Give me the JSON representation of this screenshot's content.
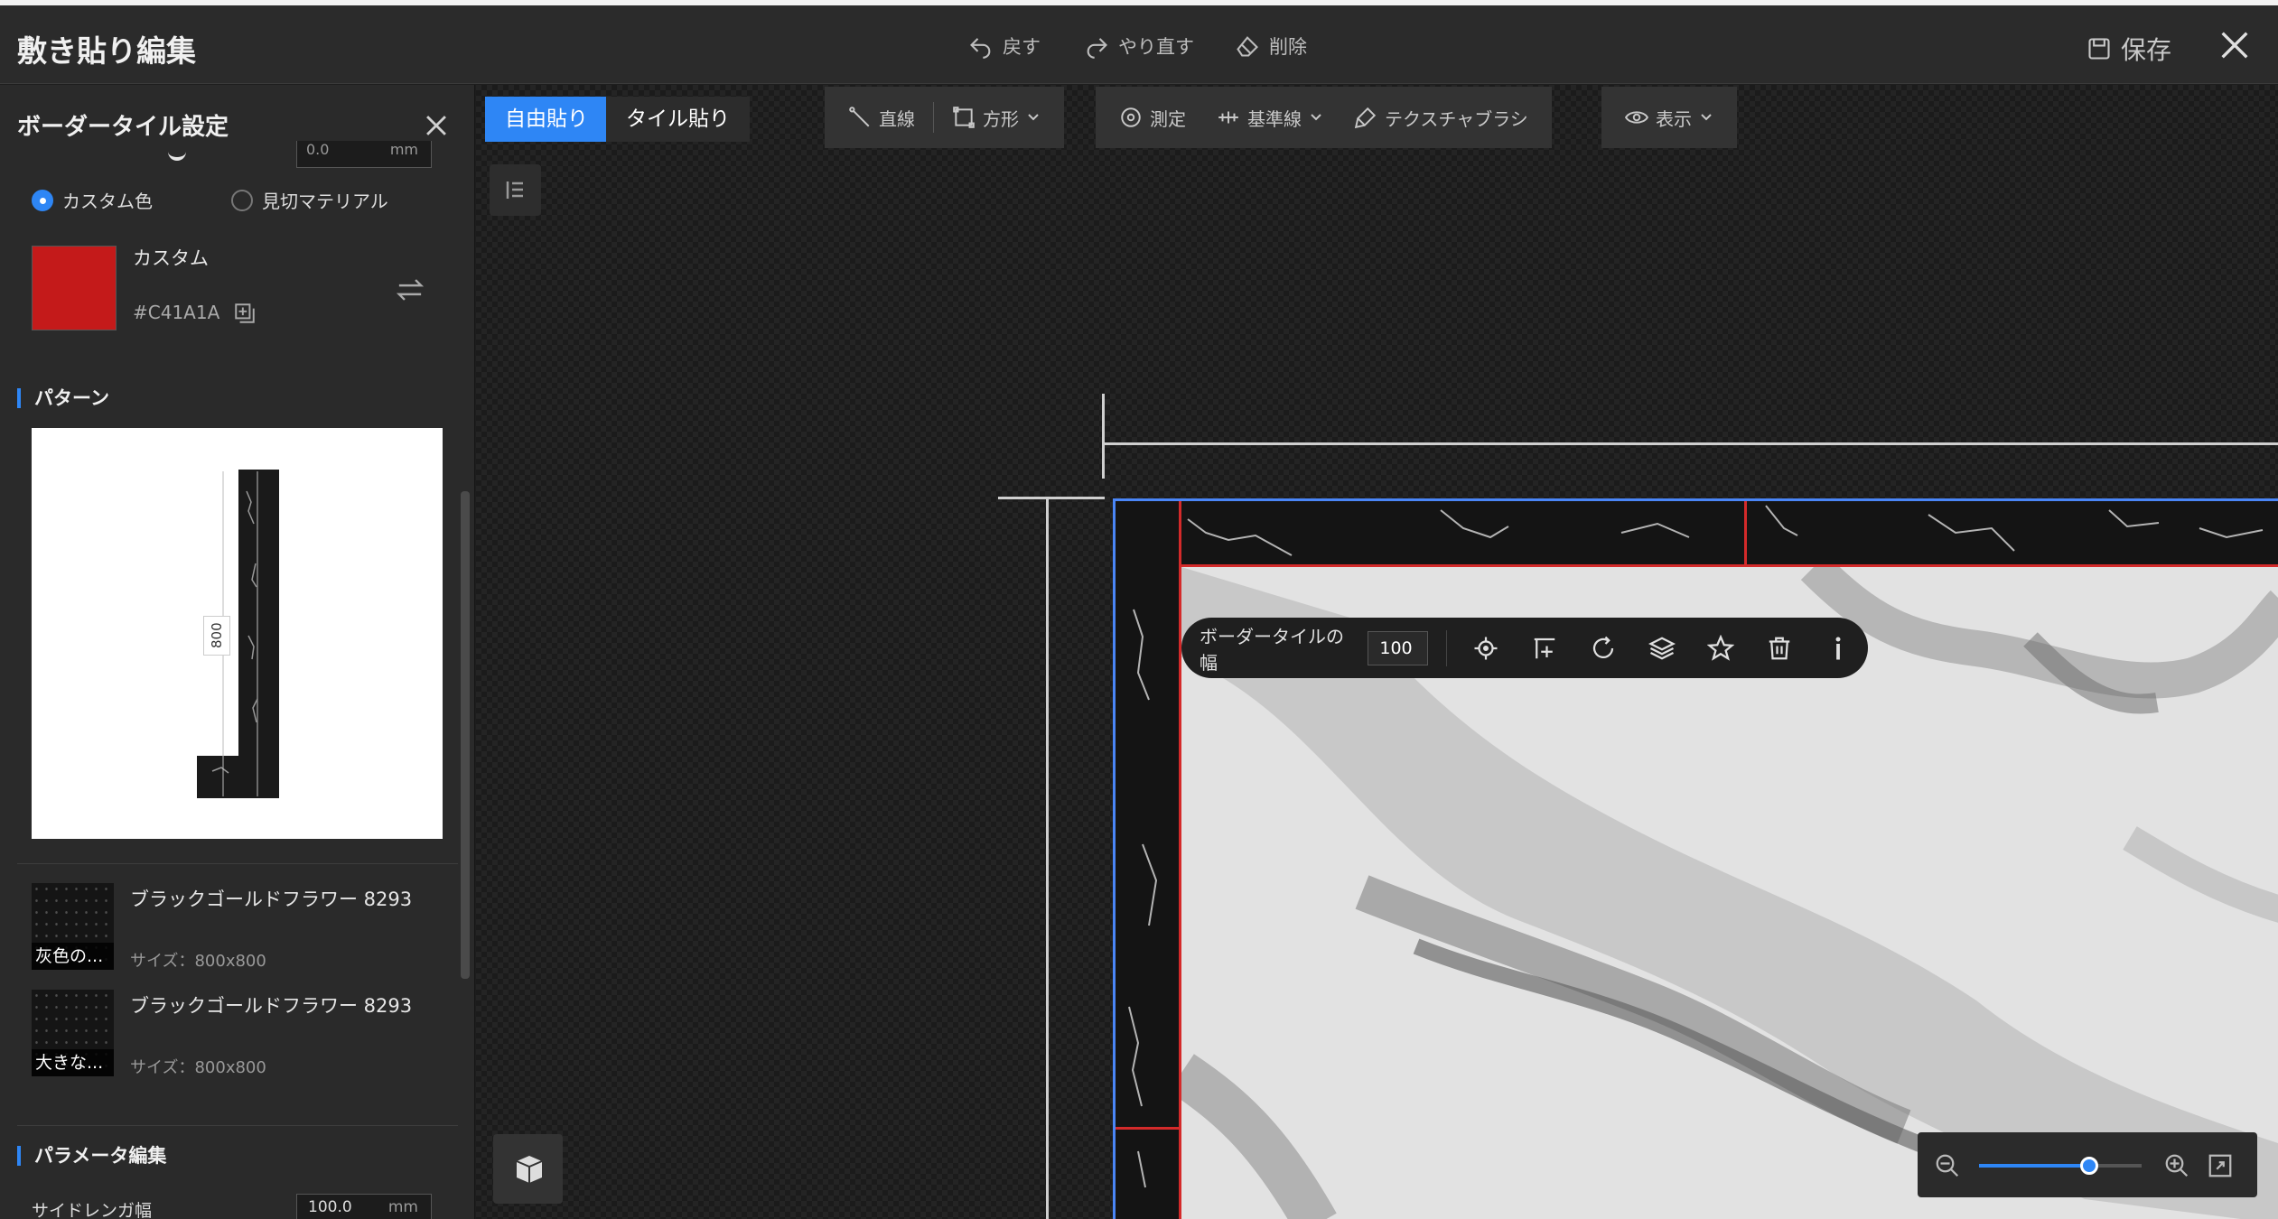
{
  "header": {
    "title": "敷き貼り編集",
    "undo_label": "戻す",
    "redo_label": "やり直す",
    "delete_label": "削除",
    "save_label": "保存"
  },
  "panel": {
    "title": "ボーダータイル設定",
    "top_partial_value": "0.0",
    "top_partial_unit": "mm",
    "radio_custom_color": "カスタム色",
    "radio_trim_material": "見切マテリアル",
    "color_name": "カスタム",
    "color_hex": "#C41A1A",
    "swatch_color": "#C41A1A",
    "pattern_section": "パターン",
    "pattern_dimension": "800",
    "materials": [
      {
        "name": "ブラックゴールドフラワー 8293",
        "tag": "灰色の...",
        "size": "サイズ：800x800"
      },
      {
        "name": "ブラックゴールドフラワー 8293",
        "tag": "大きな...",
        "size": "サイズ：800x800"
      }
    ],
    "param_section": "パラメータ編集",
    "side_length_label": "サイドレンガ幅",
    "side_length_value": "100.0",
    "side_length_unit": "mm"
  },
  "canvas": {
    "mode_free": "自由貼り",
    "mode_tile": "タイル貼り",
    "tools": {
      "line": "直線",
      "rect": "方形",
      "measure": "測定",
      "guide": "基準線",
      "texture_brush": "テクスチャブラシ",
      "view": "表示"
    },
    "floating_bar": {
      "width_label": "ボーダータイルの幅",
      "width_value": "100"
    },
    "zoom_level": 0.68
  },
  "colors": {
    "accent": "#2e86f5",
    "border_tile": "#d42a2a",
    "selection": "#4a86f7"
  }
}
